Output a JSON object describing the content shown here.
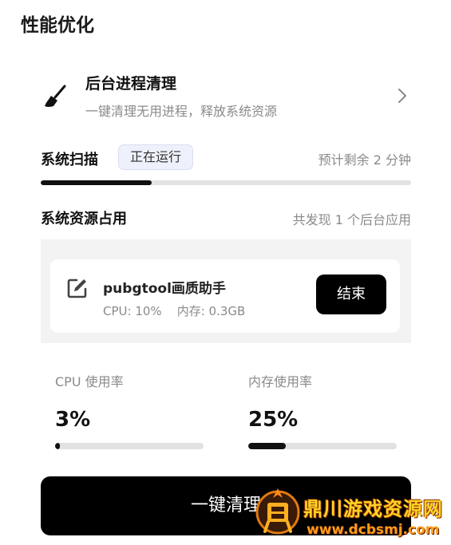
{
  "page": {
    "title": "性能优化"
  },
  "cleanup": {
    "title": "后台进程清理",
    "subtitle": "一键清理无用进程，释放系统资源",
    "icon": "broom-icon"
  },
  "scan": {
    "label": "系统扫描",
    "status": "正在运行",
    "remaining": "预计剩余 2 分钟",
    "progress": 0.3
  },
  "resources": {
    "label": "系统资源占用",
    "found": "共发现 1 个后台应用",
    "apps": [
      {
        "name": "pubgtool画质助手",
        "stats": "CPU: 10%    内存: 0.3GB",
        "end_label": "结束"
      }
    ]
  },
  "meters": {
    "cpu": {
      "label": "CPU 使用率",
      "value": "3%",
      "fraction": 0.03
    },
    "memory": {
      "label": "内存使用率",
      "value": "25%",
      "fraction": 0.25
    }
  },
  "action": {
    "label": "一键清理"
  },
  "watermark": {
    "text": "鼎川游戏资源网",
    "url": "www.dcbsmj.com"
  },
  "colors": {
    "accent": "#000000",
    "badge_bg": "#eef1fb",
    "track": "#e3e3e3"
  }
}
